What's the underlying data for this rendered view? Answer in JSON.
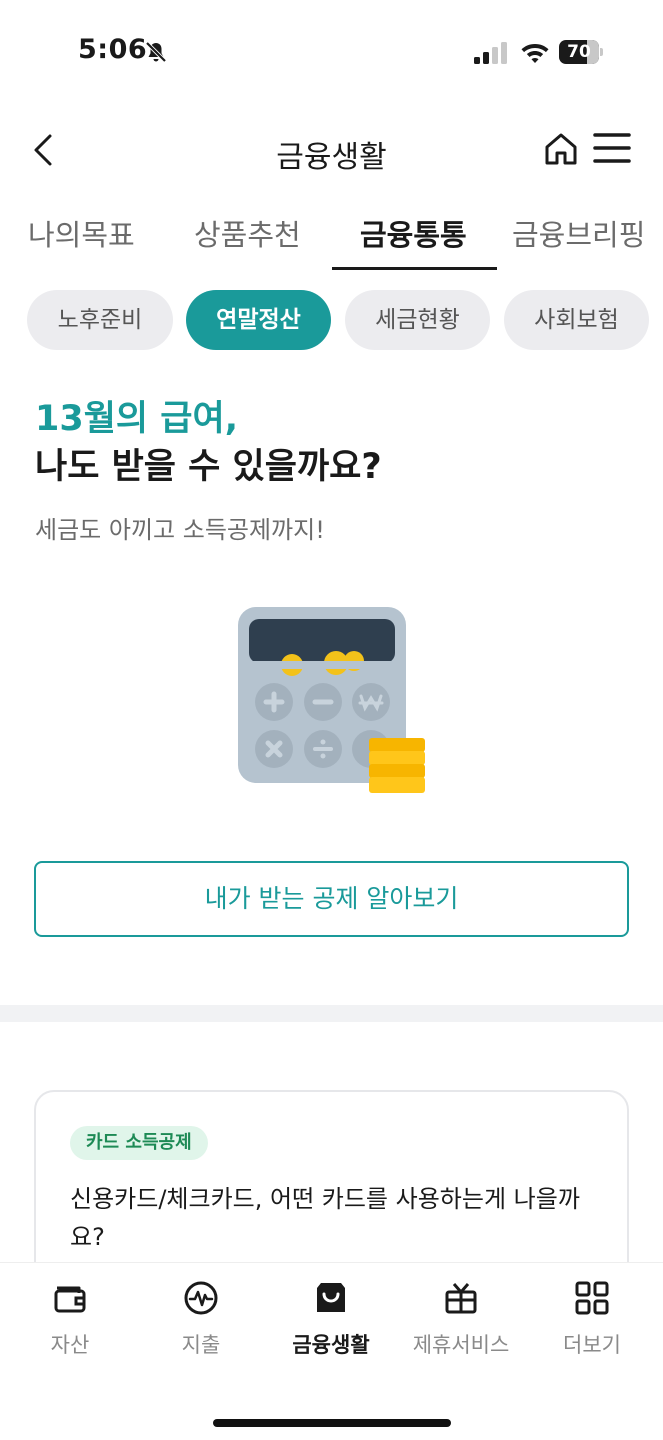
{
  "status_bar": {
    "time": "5:06",
    "battery_level": "70"
  },
  "header": {
    "title": "금융생활"
  },
  "main_tabs": [
    {
      "label": "나의목표",
      "active": false
    },
    {
      "label": "상품추천",
      "active": false
    },
    {
      "label": "금융통통",
      "active": true
    },
    {
      "label": "금융브리핑",
      "active": false
    }
  ],
  "chips": [
    {
      "label": "노후준비",
      "active": false
    },
    {
      "label": "연말정산",
      "active": true
    },
    {
      "label": "세금현황",
      "active": false
    },
    {
      "label": "사회보험",
      "active": false
    }
  ],
  "hero": {
    "title_line1": "13월의 급여,",
    "title_line2": "나도 받을 수 있을까요?",
    "subtitle": "세금도 아끼고 소득공제까지!",
    "cta_label": "내가 받는 공제 알아보기"
  },
  "card": {
    "tag": "카드 소득공제",
    "text": "신용카드/체크카드, 어떤 카드를 사용하는게 나을까요?"
  },
  "bottom_nav": [
    {
      "label": "자산",
      "icon": "wallet-icon",
      "active": false
    },
    {
      "label": "지출",
      "icon": "pulse-icon",
      "active": false
    },
    {
      "label": "금융생활",
      "icon": "shopping-bag-icon",
      "active": true
    },
    {
      "label": "제휴서비스",
      "icon": "gift-icon",
      "active": false
    },
    {
      "label": "더보기",
      "icon": "grid-icon",
      "active": false
    }
  ],
  "colors": {
    "accent": "#1a9a9a",
    "tag_bg": "#e0f5ea",
    "tag_text": "#1d8a55",
    "chip_bg": "#ececef"
  }
}
